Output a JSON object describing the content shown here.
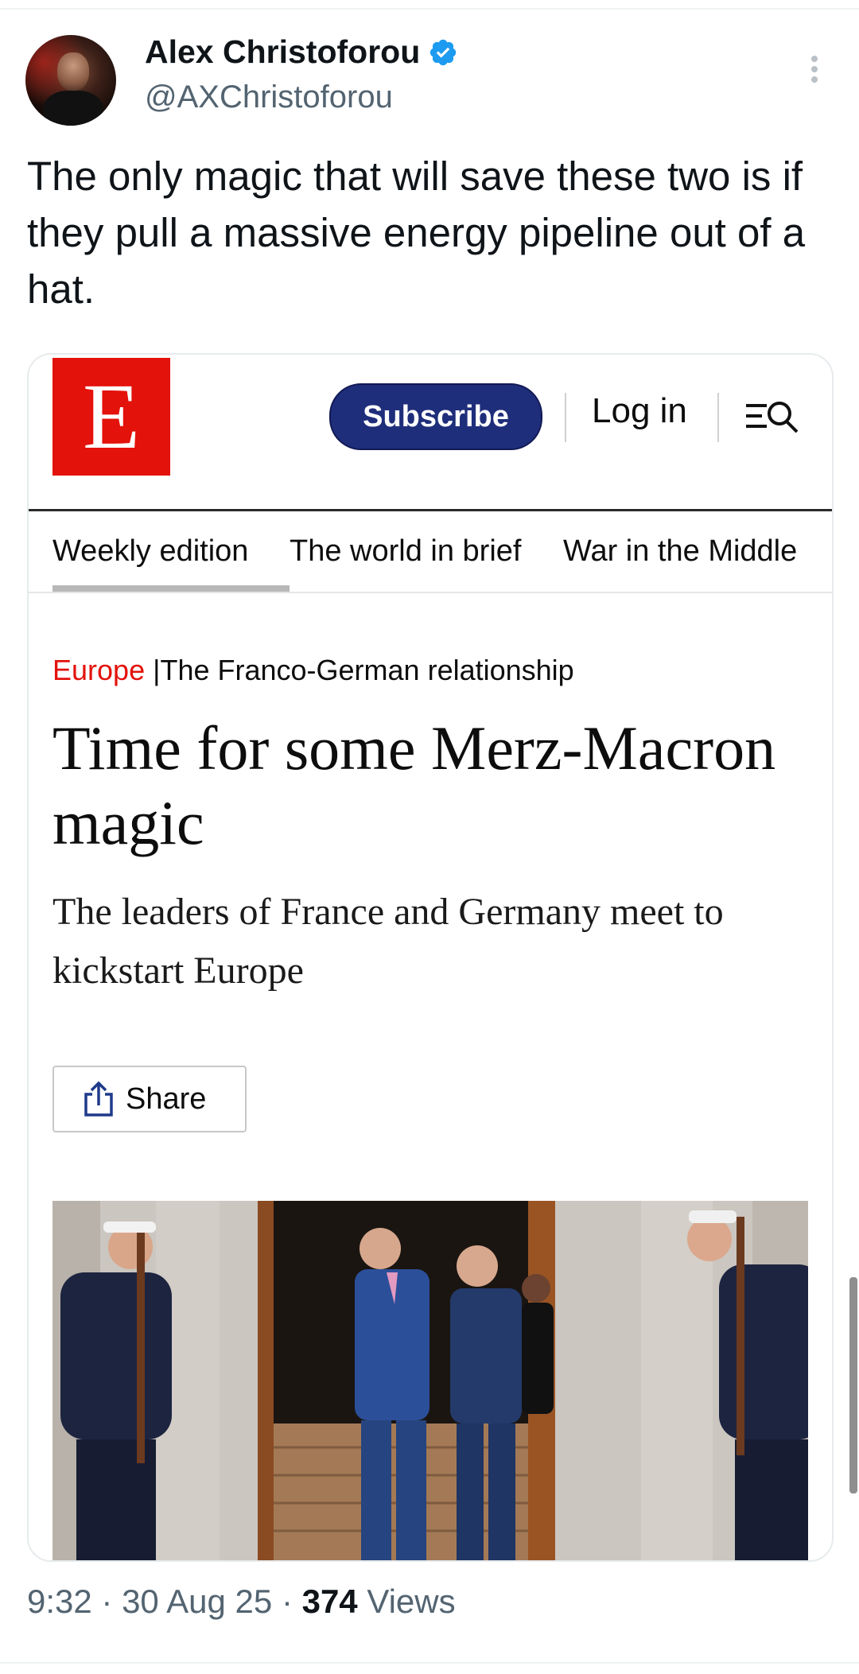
{
  "tweet": {
    "author": {
      "name": "Alex Christoforou",
      "handle": "@AXChristoforou",
      "verified": true
    },
    "text": "The only magic that will save these two is if they pull a massive energy pipeline out of a hat.",
    "timestamp": {
      "time": "9:32",
      "date": "30 Aug 25",
      "views_count": "374",
      "views_label": "Views"
    }
  },
  "card": {
    "logo_letter": "E",
    "header": {
      "subscribe_label": "Subscribe",
      "login_label": "Log in"
    },
    "nav": {
      "items": [
        "Weekly edition",
        "The world in brief",
        "War in the Middle"
      ],
      "active_index": 0
    },
    "article": {
      "section": "Europe",
      "separator": "|",
      "topic": "The Franco-German relationship",
      "headline": "Time for some Merz-Macron magic",
      "standfirst": "The leaders of France and Germany meet to kickstart Europe",
      "share_label": "Share"
    }
  },
  "colors": {
    "brand_red": "#e3120b",
    "subscribe_blue": "#1f2e7a",
    "verified_blue": "#1d9bf0",
    "secondary_text": "#536471"
  },
  "icons": [
    "verified-badge-icon",
    "more-options-icon",
    "menu-search-icon",
    "share-icon"
  ]
}
